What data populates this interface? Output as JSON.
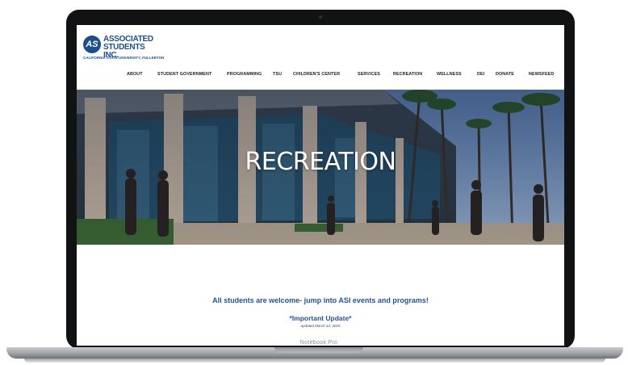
{
  "device": {
    "brand_label": "Notebook Pro"
  },
  "site": {
    "logo": {
      "mark": "AS",
      "line1": "ASSOCIATED",
      "line2": "STUDENTS INC.",
      "line3": "CALIFORNIA STATE UNIVERSITY, FULLERTON"
    },
    "nav": [
      {
        "label": "ABOUT"
      },
      {
        "label": "STUDENT GOVERNMENT"
      },
      {
        "label": "PROGRAMMING"
      },
      {
        "label": "TSU"
      },
      {
        "label": "CHILDREN'S CENTER"
      },
      {
        "label": "SERVICES"
      },
      {
        "label": "RECREATION"
      },
      {
        "label": "WELLNESS"
      },
      {
        "label": "DEI"
      },
      {
        "label": "DONATE"
      },
      {
        "label": "NEWSFEED"
      }
    ],
    "hero_title": "RECREATION",
    "welcome_text": "All students are welcome- jump into ASI events and programs!",
    "update_title": "*Important Update*",
    "update_date": "updated March 13, 2025"
  }
}
